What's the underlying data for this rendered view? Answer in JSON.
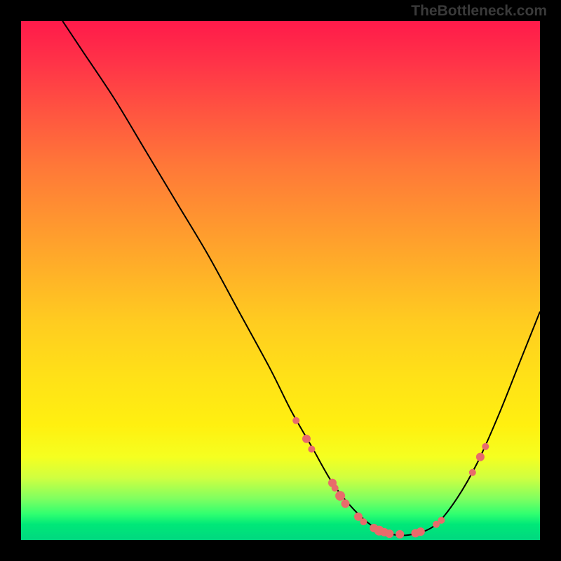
{
  "watermark": "TheBottleneck.com",
  "chart_data": {
    "type": "line",
    "title": "",
    "xlabel": "",
    "ylabel": "",
    "xlim": [
      0,
      100
    ],
    "ylim": [
      0,
      100
    ],
    "curve_points": [
      {
        "x": 8,
        "y": 100
      },
      {
        "x": 12,
        "y": 94
      },
      {
        "x": 18,
        "y": 85
      },
      {
        "x": 24,
        "y": 75
      },
      {
        "x": 30,
        "y": 65
      },
      {
        "x": 36,
        "y": 55
      },
      {
        "x": 42,
        "y": 44
      },
      {
        "x": 48,
        "y": 33
      },
      {
        "x": 52,
        "y": 25
      },
      {
        "x": 56,
        "y": 18
      },
      {
        "x": 60,
        "y": 11
      },
      {
        "x": 64,
        "y": 6
      },
      {
        "x": 68,
        "y": 2.5
      },
      {
        "x": 72,
        "y": 1
      },
      {
        "x": 76,
        "y": 1.2
      },
      {
        "x": 80,
        "y": 3
      },
      {
        "x": 84,
        "y": 8
      },
      {
        "x": 88,
        "y": 15
      },
      {
        "x": 92,
        "y": 24
      },
      {
        "x": 96,
        "y": 34
      },
      {
        "x": 100,
        "y": 44
      }
    ],
    "data_markers": [
      {
        "x": 53,
        "y": 23,
        "r": 5
      },
      {
        "x": 55,
        "y": 19.5,
        "r": 6
      },
      {
        "x": 56,
        "y": 17.5,
        "r": 5
      },
      {
        "x": 60,
        "y": 11,
        "r": 6
      },
      {
        "x": 60.5,
        "y": 10,
        "r": 5
      },
      {
        "x": 61.5,
        "y": 8.5,
        "r": 7
      },
      {
        "x": 62.5,
        "y": 7,
        "r": 6
      },
      {
        "x": 65,
        "y": 4.5,
        "r": 6
      },
      {
        "x": 66,
        "y": 3.5,
        "r": 5
      },
      {
        "x": 68,
        "y": 2.3,
        "r": 6
      },
      {
        "x": 69,
        "y": 1.8,
        "r": 7
      },
      {
        "x": 70,
        "y": 1.5,
        "r": 6
      },
      {
        "x": 71,
        "y": 1.2,
        "r": 6
      },
      {
        "x": 73,
        "y": 1.1,
        "r": 6
      },
      {
        "x": 76,
        "y": 1.3,
        "r": 6
      },
      {
        "x": 77,
        "y": 1.6,
        "r": 6
      },
      {
        "x": 80,
        "y": 3,
        "r": 5
      },
      {
        "x": 81,
        "y": 3.8,
        "r": 5
      },
      {
        "x": 87,
        "y": 13,
        "r": 5
      },
      {
        "x": 88.5,
        "y": 16,
        "r": 6
      },
      {
        "x": 89.5,
        "y": 18,
        "r": 5
      }
    ]
  }
}
